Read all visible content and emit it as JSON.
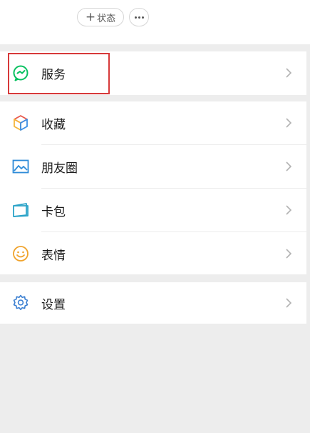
{
  "top": {
    "status_label": "状态",
    "plus_symbol": "+",
    "more_icon": "more-dots-icon"
  },
  "menu": {
    "service": {
      "label": "服务",
      "icon": "service-icon",
      "color": "#07c160"
    },
    "items": [
      {
        "label": "收藏",
        "icon": "favorites-cube-icon"
      },
      {
        "label": "朋友圈",
        "icon": "moments-picture-icon",
        "color": "#2e8bd8"
      },
      {
        "label": "卡包",
        "icon": "card-wallet-icon",
        "color": "#2aa3c8"
      },
      {
        "label": "表情",
        "icon": "emoji-smile-icon",
        "color": "#f0a32c"
      }
    ],
    "settings": {
      "label": "设置",
      "icon": "settings-gear-icon",
      "color": "#3b7fd1"
    }
  },
  "highlight": {
    "target": "服务",
    "color": "#d7393a"
  },
  "colors": {
    "background": "#ededed",
    "panel": "#ffffff",
    "text": "#1a1a1a",
    "chevron": "#b2b2b2"
  }
}
